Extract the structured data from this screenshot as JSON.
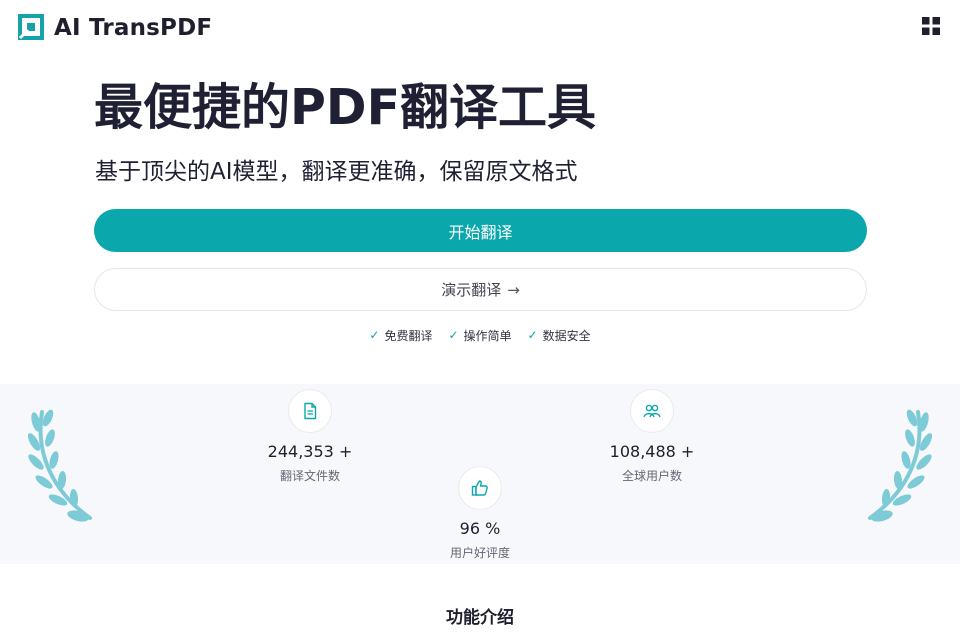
{
  "header": {
    "brand": "AI TransPDF",
    "logo_icon": "square-logo-icon",
    "menu_icon": "grid-menu-icon"
  },
  "hero": {
    "title": "最便捷的PDF翻译工具",
    "subtitle": "基于顶尖的AI模型，翻译更准确，保留原文格式",
    "primary_button": "开始翻译",
    "secondary_button": "演示翻译",
    "secondary_icon": "arrow-right-icon",
    "features": [
      "免费翻译",
      "操作简单",
      "数据安全"
    ]
  },
  "stats": {
    "files": {
      "value": "244,353 +",
      "label": "翻译文件数",
      "icon": "document-icon"
    },
    "users": {
      "value": "108,488 +",
      "label": "全球用户数",
      "icon": "users-icon"
    },
    "rating": {
      "value": "96 %",
      "label": "用户好评度",
      "icon": "thumbs-up-icon"
    }
  },
  "section": {
    "title": "功能介绍"
  },
  "colors": {
    "accent": "#0aa8ad",
    "laurel": "#7ccbd6",
    "band_bg": "#f7f8fb"
  }
}
